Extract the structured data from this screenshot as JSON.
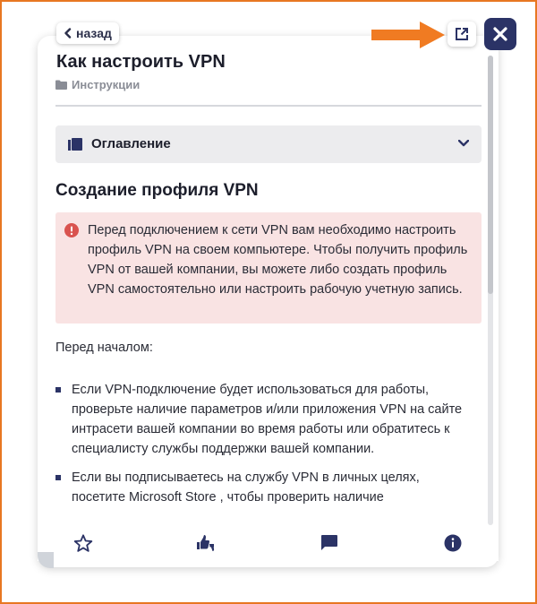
{
  "header": {
    "back_label": "назад"
  },
  "article": {
    "title": "Как настроить VPN",
    "category": "Инструкции"
  },
  "toc": {
    "label": "Оглавление"
  },
  "section": {
    "title": "Создание профиля VPN",
    "alert_text": "Перед подключением к сети VPN вам необходимо настроить профиль VPN на своем компьютере. Чтобы получить профиль VPN от вашей компании, вы можете либо создать профиль VPN самостоятельно или настроить рабочую учетную запись.",
    "intro": "Перед началом:",
    "bullets": [
      "Если VPN-подключение будет использоваться для работы, проверьте наличие параметров и/или приложения VPN на сайте интрасети вашей компании во время работы или обратитесь к специалисту службы поддержки вашей компании.",
      "Если вы подписываетесь на службу VPN в личных целях, посетите Microsoft Store , чтобы проверить наличие"
    ]
  },
  "footer": {
    "icons": [
      "star-icon",
      "thumbs-icon",
      "comment-icon",
      "info-icon"
    ]
  },
  "colors": {
    "accent": "#2b3366",
    "arrow": "#f07b22",
    "alert_bg": "#f9e3e3",
    "alert_icon": "#d9534f",
    "frame": "#e87722"
  }
}
